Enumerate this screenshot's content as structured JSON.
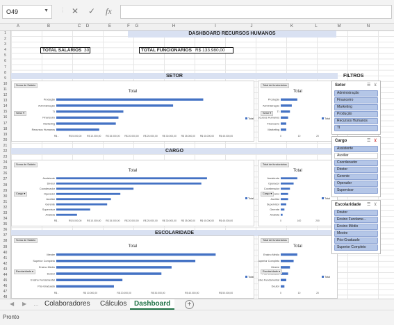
{
  "formula_bar": {
    "cell_ref": "O49",
    "cancel_icon": "✕",
    "enter_icon": "✓",
    "fx_label": "fx",
    "formula": ""
  },
  "columns": [
    "A",
    "B",
    "C",
    "D",
    "E",
    "F",
    "G",
    "H",
    "I",
    "J",
    "K",
    "L",
    "M",
    "N"
  ],
  "rows": [
    "1",
    "2",
    "3",
    "4",
    "5",
    "6",
    "7",
    "8",
    "9",
    "10",
    "11",
    "12",
    "13",
    "14",
    "15",
    "16",
    "17",
    "18",
    "19",
    "20",
    "21",
    "22",
    "23",
    "24",
    "25",
    "26",
    "27",
    "28",
    "29",
    "30",
    "31",
    "32",
    "33",
    "34",
    "35",
    "36",
    "37",
    "38",
    "39",
    "40",
    "41",
    "42",
    "43",
    "44",
    "45",
    "46",
    "47",
    "48",
    "49",
    "50",
    "51"
  ],
  "selected_row": "49",
  "dashboard": {
    "title": "DASHBOARD RECURSOS HUMANOS",
    "kpi_salarios_label": "TOTAL SALÁRIOS",
    "kpi_salarios_value": "30",
    "kpi_funcionarios_label": "TOTAL FUNCIONÁRIOS",
    "kpi_funcionarios_value": "R$ 133.980,00",
    "section_setor": "SETOR",
    "section_cargo": "CARGO",
    "section_escolaridade": "ESCOLARIDADE",
    "filters_label": "FILTROS"
  },
  "charts": {
    "setor_sal": {
      "tag": "Soma de Salário",
      "title": "Total",
      "field": "Setor",
      "legend": "Total"
    },
    "setor_func": {
      "tag": "Total de funcionários",
      "title": "Total",
      "field": "Setor",
      "legend": "Total"
    },
    "cargo_sal": {
      "tag": "Soma de Salário",
      "title": "Total",
      "field": "Cargo",
      "legend": "Total"
    },
    "cargo_func": {
      "tag": "Total de funcionários",
      "title": "Total",
      "field": "Cargo",
      "legend": "Total"
    },
    "esc_sal": {
      "tag": "Soma de Salário",
      "title": "Total",
      "field": "Escolaridade",
      "legend": "Total"
    },
    "esc_func": {
      "tag": "Total de funcionários",
      "title": "Total",
      "field": "Escolaridade",
      "legend": "Total"
    }
  },
  "chart_data": [
    {
      "id": "setor_sal",
      "type": "bar",
      "categories": [
        "Produção",
        "Administração",
        "TI",
        "Financeiro",
        "Marketing",
        "Recursos Humanos"
      ],
      "values": [
        39000,
        31000,
        17800,
        16500,
        15800,
        11400
      ],
      "xticks": [
        "R$ -",
        "R$ 5.000,00",
        "R$ 10.000,00",
        "R$ 15.000,00",
        "R$ 20.000,00",
        "R$ 25.000,00",
        "R$ 30.000,00",
        "R$ 35.000,00",
        "R$ 40.000,00",
        "R$ 45.000,00"
      ],
      "xlim": [
        0,
        45000
      ]
    },
    {
      "id": "setor_func",
      "type": "bar",
      "categories": [
        "Produção",
        "Administração",
        "TI",
        "Recursos Humanos",
        "Financeiro",
        "Marketing"
      ],
      "values": [
        9,
        6,
        5,
        4,
        3,
        3
      ],
      "xticks": [
        "0",
        "10",
        "20"
      ],
      "xlim": [
        0,
        20
      ]
    },
    {
      "id": "cargo_sal",
      "type": "bar",
      "categories": [
        "Assistente",
        "Diretor",
        "Coordenador",
        "Operador",
        "Auxiliar",
        "Gerente",
        "Supervisor",
        "Analista"
      ],
      "values": [
        40000,
        38500,
        20500,
        17000,
        14500,
        13500,
        9000,
        5500
      ],
      "xticks": [
        "R$ -",
        "R$ 5.000,00",
        "R$ 10.000,00",
        "R$ 15.000,00",
        "R$ 20.000,00",
        "R$ 25.000,00",
        "R$ 30.000,00",
        "R$ 35.000,00",
        "R$ 40.000,00",
        "R$ 45.000,00"
      ],
      "xlim": [
        0,
        45000
      ]
    },
    {
      "id": "cargo_func",
      "type": "bar",
      "categories": [
        "Assistente",
        "Operador",
        "Coordenador",
        "Diretor",
        "Auxiliar",
        "Supervisor",
        "Gerente",
        "Analista"
      ],
      "values": [
        9,
        7,
        5,
        4,
        4,
        3,
        2,
        1
      ],
      "xticks": [
        "0",
        "100",
        "200"
      ],
      "xlim": [
        0,
        20
      ]
    },
    {
      "id": "esc_sal",
      "type": "bar",
      "categories": [
        "Mestre",
        "Superior Completo",
        "Ensino Médio",
        "Doutor",
        "Ensino Fundamental",
        "Pós-Graduado"
      ],
      "values": [
        47000,
        41000,
        34000,
        31000,
        19500,
        17000
      ],
      "xticks": [
        "R$ -",
        "R$ 10.000,00",
        "R$ 20.000,00",
        "R$ 30.000,00",
        "R$ 40.000,00",
        "R$ 50.000,00"
      ],
      "xlim": [
        0,
        50000
      ]
    },
    {
      "id": "esc_func",
      "type": "bar",
      "categories": [
        "Ensino Médio",
        "Superior Completo",
        "Mestre",
        "Pós-Graduado",
        "Ensino Fundamental",
        "Doutor"
      ],
      "values": [
        9,
        7,
        5,
        4,
        3,
        2
      ],
      "xticks": [
        "0",
        "10",
        "20"
      ],
      "xlim": [
        0,
        20
      ]
    }
  ],
  "slicers": {
    "setor": {
      "title": "Setor",
      "items": [
        {
          "label": "Administração",
          "selected": true
        },
        {
          "label": "Financeiro",
          "selected": true
        },
        {
          "label": "Marketing",
          "selected": true
        },
        {
          "label": "Produção",
          "selected": true
        },
        {
          "label": "Recursos Humanos",
          "selected": true
        },
        {
          "label": "TI",
          "selected": true
        }
      ]
    },
    "cargo": {
      "title": "Cargo",
      "items": [
        {
          "label": "Assistente",
          "selected": true
        },
        {
          "label": "Auxiliar",
          "selected": false
        },
        {
          "label": "Coordenador",
          "selected": true
        },
        {
          "label": "Diretor",
          "selected": true
        },
        {
          "label": "Gerente",
          "selected": true
        },
        {
          "label": "Operador",
          "selected": true
        },
        {
          "label": "Supervisor",
          "selected": true
        }
      ]
    },
    "escolaridade": {
      "title": "Escolaridade",
      "items": [
        {
          "label": "Doutor",
          "selected": true
        },
        {
          "label": "Ensino Fundame...",
          "selected": true
        },
        {
          "label": "Ensino Médio",
          "selected": true
        },
        {
          "label": "Mestre",
          "selected": true
        },
        {
          "label": "Pós-Graduado",
          "selected": true
        },
        {
          "label": "Superior Completo",
          "selected": true
        }
      ]
    }
  },
  "sheet_tabs": {
    "tab1": "Colaboradores",
    "tab2": "Cálculos",
    "tab3": "Dashboard",
    "active": "Dashboard"
  },
  "status": {
    "text": "Pronto"
  },
  "colors": {
    "bar": "#4472c4",
    "header_band": "#d9e1f2",
    "slicer_selected": "#b4c6e7",
    "active_tab": "#1e7145"
  }
}
